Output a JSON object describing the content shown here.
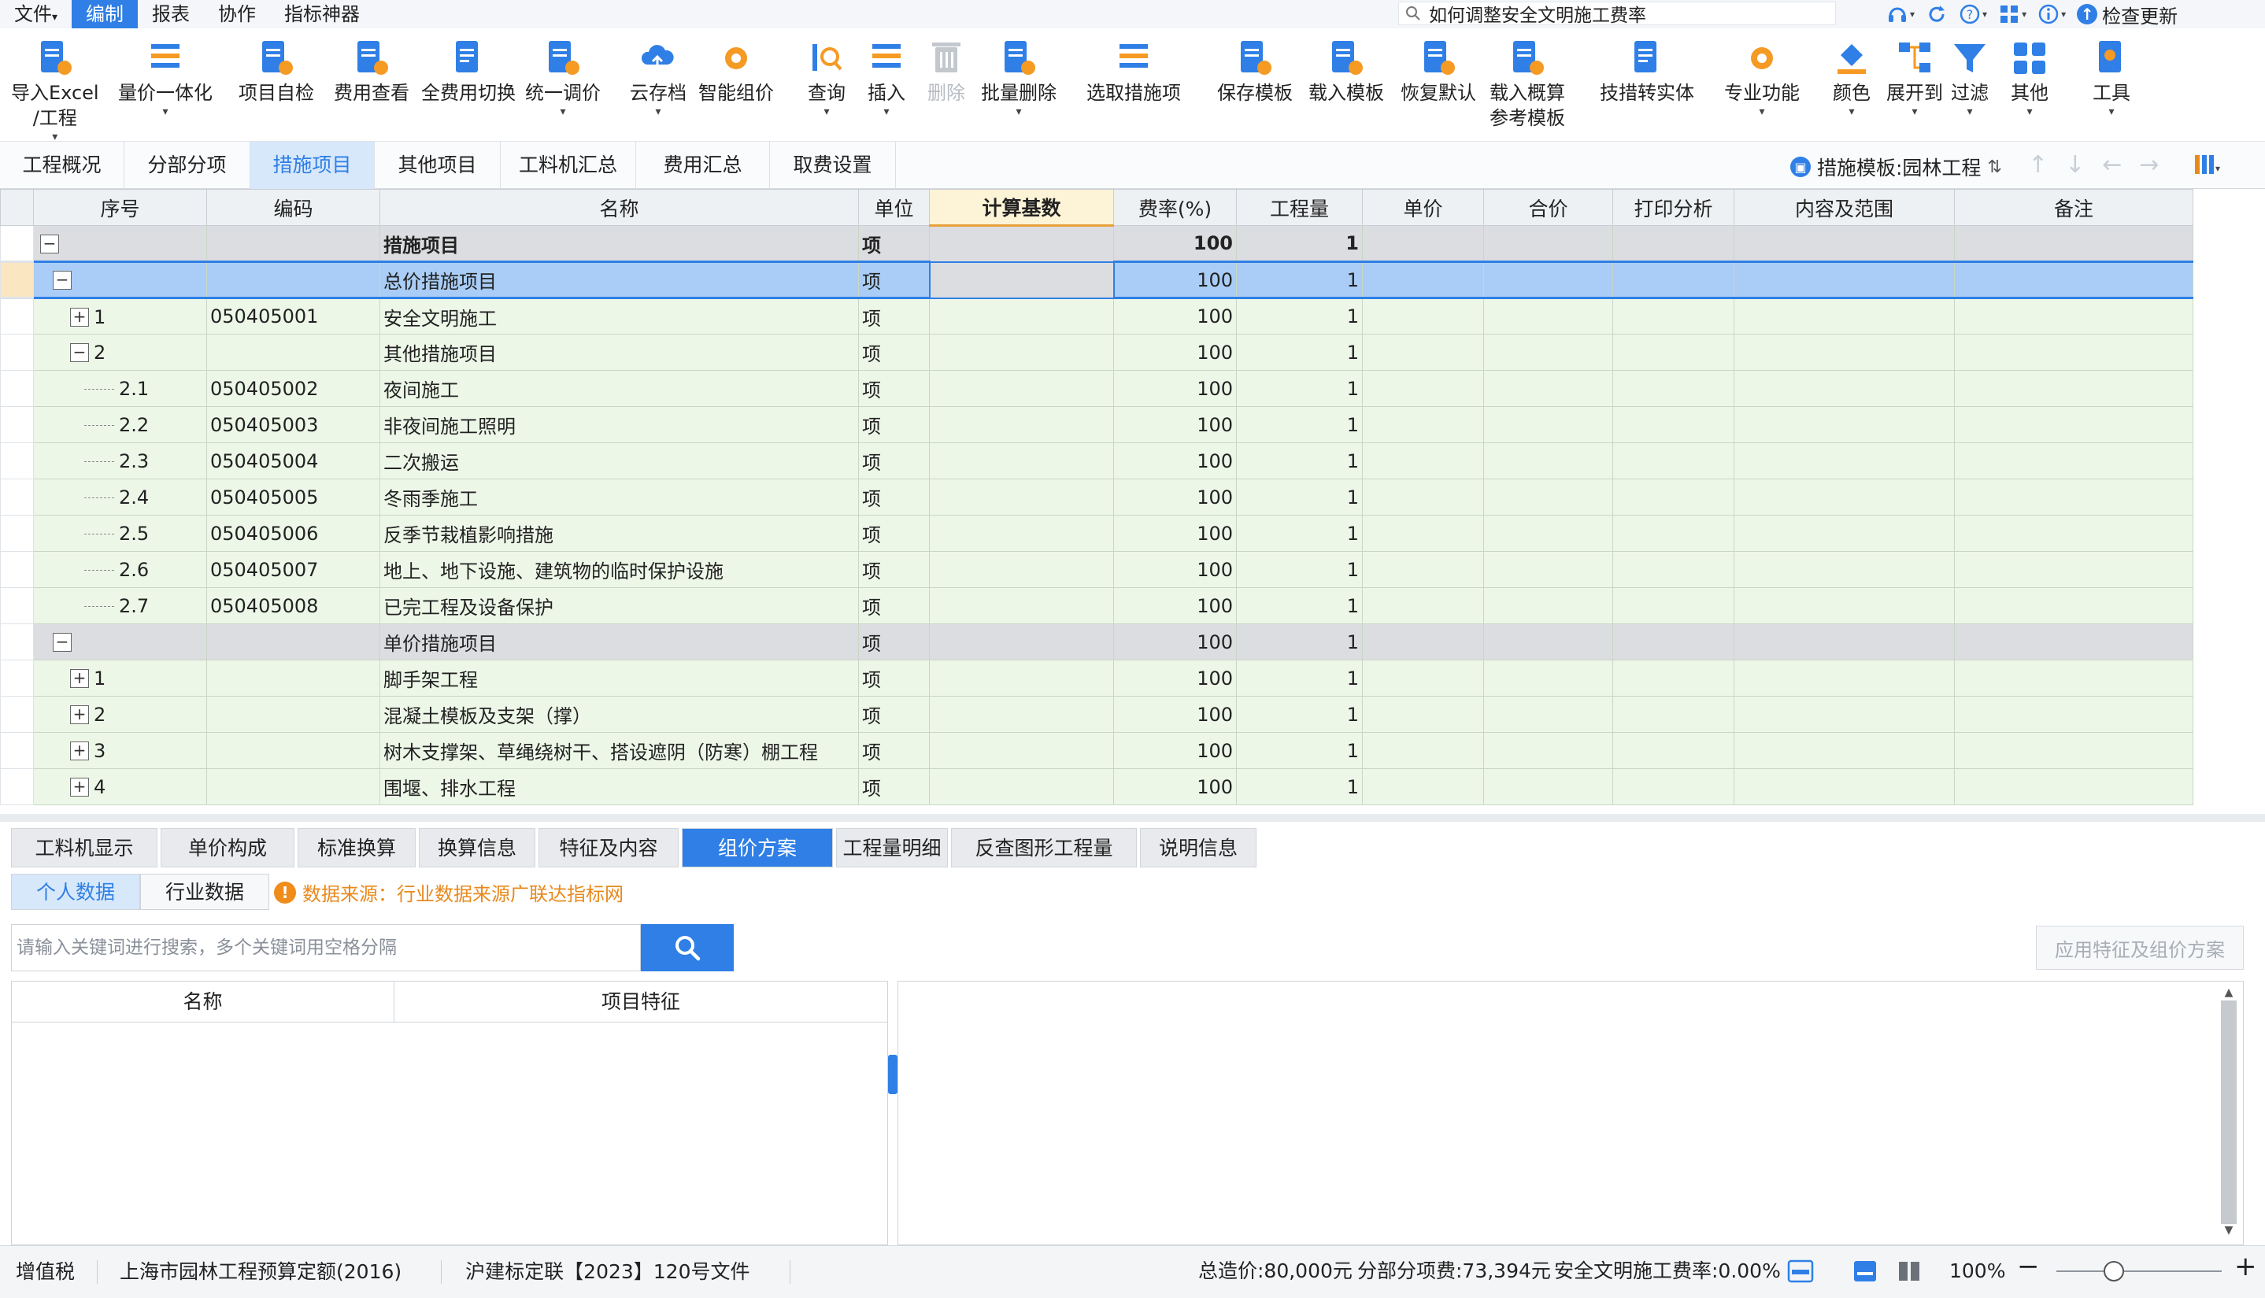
{
  "menu": {
    "items": [
      "文件",
      "编制",
      "报表",
      "协作",
      "指标神器"
    ],
    "active_index": 1,
    "file_caret": "▾"
  },
  "top_search": {
    "value": "如何调整安全文明施工费率"
  },
  "top_right": {
    "check_update": "检查更新"
  },
  "ribbon": {
    "buttons": [
      {
        "label": "导入Excel",
        "label2": "/工程",
        "icon": "import-excel-icon",
        "caret": true
      },
      {
        "label": "量价一体化",
        "icon": "qty-price-icon",
        "caret": true
      },
      {
        "label": "项目自检",
        "icon": "self-check-icon"
      },
      {
        "label": "费用查看",
        "icon": "fee-view-icon"
      },
      {
        "label": "全费用切换",
        "icon": "full-fee-switch-icon"
      },
      {
        "label": "统一调价",
        "icon": "unified-pricing-icon",
        "caret": true
      },
      {
        "label": "云存档",
        "icon": "cloud-archive-icon",
        "caret": true
      },
      {
        "label": "智能组价",
        "icon": "smart-pricing-icon"
      },
      {
        "label": "查询",
        "icon": "query-icon",
        "caret": true
      },
      {
        "label": "插入",
        "icon": "insert-icon",
        "caret": true
      },
      {
        "label": "删除",
        "icon": "delete-icon",
        "disabled": true
      },
      {
        "label": "批量删除",
        "icon": "batch-delete-icon",
        "caret": true
      },
      {
        "label": "选取措施项",
        "icon": "select-measure-icon"
      },
      {
        "label": "保存模板",
        "icon": "save-template-icon"
      },
      {
        "label": "载入模板",
        "icon": "load-template-icon"
      },
      {
        "label": "恢复默认",
        "icon": "restore-default-icon"
      },
      {
        "label": "载入概算",
        "label2": "参考模板",
        "icon": "load-estimate-icon"
      },
      {
        "label": "技措转实体",
        "icon": "convert-entity-icon"
      },
      {
        "label": "专业功能",
        "icon": "professional-icon",
        "caret": true
      },
      {
        "label": "颜色",
        "icon": "color-icon",
        "caret": true
      },
      {
        "label": "展开到",
        "icon": "expand-to-icon",
        "caret": true
      },
      {
        "label": "过滤",
        "icon": "filter-icon",
        "caret": true
      },
      {
        "label": "其他",
        "icon": "other-icon",
        "caret": true
      },
      {
        "label": "工具",
        "icon": "tools-icon",
        "caret": true
      }
    ]
  },
  "main_tabs": [
    "工程概况",
    "分部分项",
    "措施项目",
    "其他项目",
    "工料机汇总",
    "费用汇总",
    "取费设置"
  ],
  "main_tab_active": 2,
  "template_info": {
    "label": "措施模板:园林工程"
  },
  "grid": {
    "columns": [
      "序号",
      "编码",
      "名称",
      "单位",
      "计算基数",
      "费率(%)",
      "工程量",
      "单价",
      "合价",
      "打印分析",
      "内容及范围",
      "备注"
    ],
    "rows": [
      {
        "toggle": "−",
        "level": 0,
        "seq": "",
        "code": "",
        "name": "措施项目",
        "unit": "项",
        "base": "",
        "rate": "100",
        "qty": "1",
        "style": "gray",
        "bold": true
      },
      {
        "toggle": "−",
        "level": 1,
        "seq": "",
        "code": "",
        "name": "总价措施项目",
        "unit": "项",
        "base": "",
        "rate": "100",
        "qty": "1",
        "style": "sel"
      },
      {
        "toggle": "+",
        "level": 2,
        "seq": "1",
        "code": "050405001",
        "name": "安全文明施工",
        "unit": "项",
        "base": "",
        "rate": "100",
        "qty": "1",
        "style": "green"
      },
      {
        "toggle": "−",
        "level": 2,
        "seq": "2",
        "code": "",
        "name": "其他措施项目",
        "unit": "项",
        "base": "",
        "rate": "100",
        "qty": "1",
        "style": "green"
      },
      {
        "toggle": "",
        "level": 3,
        "seq": "2.1",
        "code": "050405002",
        "name": "夜间施工",
        "unit": "项",
        "base": "",
        "rate": "100",
        "qty": "1",
        "style": "green"
      },
      {
        "toggle": "",
        "level": 3,
        "seq": "2.2",
        "code": "050405003",
        "name": "非夜间施工照明",
        "unit": "项",
        "base": "",
        "rate": "100",
        "qty": "1",
        "style": "green"
      },
      {
        "toggle": "",
        "level": 3,
        "seq": "2.3",
        "code": "050405004",
        "name": "二次搬运",
        "unit": "项",
        "base": "",
        "rate": "100",
        "qty": "1",
        "style": "green"
      },
      {
        "toggle": "",
        "level": 3,
        "seq": "2.4",
        "code": "050405005",
        "name": "冬雨季施工",
        "unit": "项",
        "base": "",
        "rate": "100",
        "qty": "1",
        "style": "green"
      },
      {
        "toggle": "",
        "level": 3,
        "seq": "2.5",
        "code": "050405006",
        "name": "反季节栽植影响措施",
        "unit": "项",
        "base": "",
        "rate": "100",
        "qty": "1",
        "style": "green"
      },
      {
        "toggle": "",
        "level": 3,
        "seq": "2.6",
        "code": "050405007",
        "name": "地上、地下设施、建筑物的临时保护设施",
        "unit": "项",
        "base": "",
        "rate": "100",
        "qty": "1",
        "style": "green"
      },
      {
        "toggle": "",
        "level": 3,
        "seq": "2.7",
        "code": "050405008",
        "name": "已完工程及设备保护",
        "unit": "项",
        "base": "",
        "rate": "100",
        "qty": "1",
        "style": "green"
      },
      {
        "toggle": "−",
        "level": 1,
        "seq": "",
        "code": "",
        "name": "单价措施项目",
        "unit": "项",
        "base": "",
        "rate": "100",
        "qty": "1",
        "style": "gray"
      },
      {
        "toggle": "+",
        "level": 2,
        "seq": "1",
        "code": "",
        "name": "脚手架工程",
        "unit": "项",
        "base": "",
        "rate": "100",
        "qty": "1",
        "style": "green"
      },
      {
        "toggle": "+",
        "level": 2,
        "seq": "2",
        "code": "",
        "name": "混凝土模板及支架（撑）",
        "unit": "项",
        "base": "",
        "rate": "100",
        "qty": "1",
        "style": "green"
      },
      {
        "toggle": "+",
        "level": 2,
        "seq": "3",
        "code": "",
        "name": "树木支撑架、草绳绕树干、搭设遮阴（防寒）棚工程",
        "unit": "项",
        "base": "",
        "rate": "100",
        "qty": "1",
        "style": "green"
      },
      {
        "toggle": "+",
        "level": 2,
        "seq": "4",
        "code": "",
        "name": "围堰、排水工程",
        "unit": "项",
        "base": "",
        "rate": "100",
        "qty": "1",
        "style": "green"
      }
    ]
  },
  "bottom_tabs": [
    "工料机显示",
    "单价构成",
    "标准换算",
    "换算信息",
    "特征及内容",
    "组价方案",
    "工程量明细",
    "反查图形工程量",
    "说明信息"
  ],
  "bottom_tab_active": 5,
  "data_tabs": [
    "个人数据",
    "行业数据"
  ],
  "data_tab_active": 0,
  "data_source": "数据来源：行业数据来源广联达指标网",
  "keyword_search": {
    "placeholder": "请输入关键词进行搜索，多个关键词用空格分隔"
  },
  "apply_button": "应用特征及组价方案",
  "list_columns": [
    "名称",
    "项目特征"
  ],
  "status": {
    "tax": "增值税",
    "quota": "上海市园林工程预算定额(2016)",
    "file": "沪建标定联【2023】120号文件",
    "total": "总造价:80,000元",
    "section_fee": "分部分项费:73,394元",
    "safety_rate": "安全文明施工费率:0.00%",
    "zoom": "100%",
    "zoom_minus": "−",
    "zoom_plus": "+"
  },
  "colors": {
    "accent": "#2f7fe6",
    "row_green": "#edf7e8",
    "row_gray": "#dcdde0",
    "warn": "#f08c1a"
  }
}
